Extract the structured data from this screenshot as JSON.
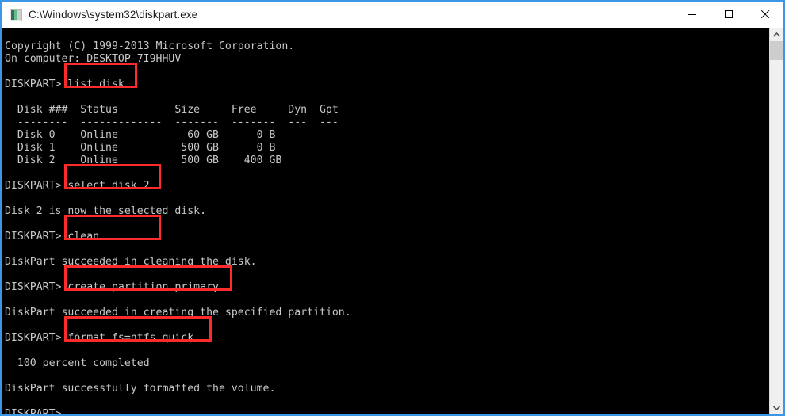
{
  "window": {
    "title": "C:\\Windows\\system32\\diskpart.exe",
    "icon": "console-app-icon",
    "border_color": "#3b97e3",
    "controls": {
      "minimize_label": "Minimize",
      "maximize_label": "Maximize",
      "close_label": "Close"
    }
  },
  "console": {
    "background": "#000000",
    "foreground": "#c8c8c8",
    "highlight_color": "#ff2a2a",
    "prompt": "DISKPART>",
    "lines": [
      "Copyright (C) 1999-2013 Microsoft Corporation.",
      "On computer: DESKTOP-7I9HHUV",
      "",
      "DISKPART> list disk",
      "",
      "  Disk ###  Status         Size     Free     Dyn  Gpt",
      "  --------  -------------  -------  -------  ---  ---",
      "  Disk 0    Online           60 GB      0 B",
      "  Disk 1    Online          500 GB      0 B",
      "  Disk 2    Online          500 GB    400 GB",
      "",
      "DISKPART> select disk 2",
      "",
      "Disk 2 is now the selected disk.",
      "",
      "DISKPART> clean",
      "",
      "DiskPart succeeded in cleaning the disk.",
      "",
      "DISKPART> create partition primary",
      "",
      "DiskPart succeeded in creating the specified partition.",
      "",
      "DISKPART> format fs=ntfs quick",
      "",
      "  100 percent completed",
      "",
      "DiskPart successfully formatted the volume.",
      "",
      "DISKPART>"
    ],
    "disk_table": {
      "headers": [
        "Disk ###",
        "Status",
        "Size",
        "Free",
        "Dyn",
        "Gpt"
      ],
      "rows": [
        [
          "Disk 0",
          "Online",
          "60 GB",
          "0 B",
          "",
          ""
        ],
        [
          "Disk 1",
          "Online",
          "500 GB",
          "0 B",
          "",
          ""
        ],
        [
          "Disk 2",
          "Online",
          "500 GB",
          "400 GB",
          "",
          ""
        ]
      ]
    },
    "highlighted_commands": [
      "list disk",
      "select disk 2",
      "clean",
      "create partition primary",
      "format fs=ntfs quick"
    ],
    "messages": [
      "Disk 2 is now the selected disk.",
      "DiskPart succeeded in cleaning the disk.",
      "DiskPart succeeded in creating the specified partition.",
      "100 percent completed",
      "DiskPart successfully formatted the volume."
    ]
  },
  "scrollbar": {
    "up_arrow": "chevron-up-icon",
    "down_arrow": "chevron-down-icon",
    "thumb_label": "scrollbar-thumb"
  }
}
